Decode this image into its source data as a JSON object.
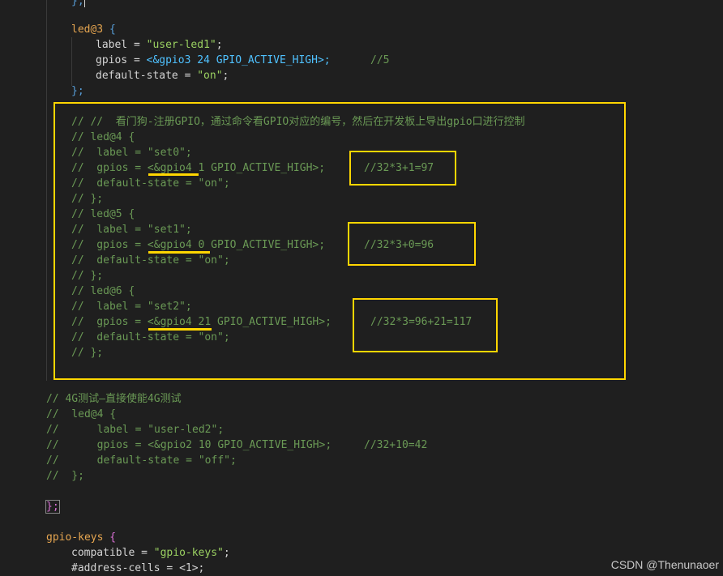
{
  "code": {
    "top_fragment": "};",
    "led3": {
      "name": "led@3",
      "open": "{",
      "label_key": "label",
      "label_value": "\"user-led1\"",
      "gpios_key": "gpios",
      "gpios_value": "<&gpio3 24 GPIO_ACTIVE_HIGH>;",
      "gpios_comment": "//5",
      "state_key": "default-state",
      "state_value": "\"on\"",
      "close": "};"
    },
    "block1": {
      "title": "// //  看门狗-注册GPIO，通过命令看GPIO对应的编号，然后在开发板上导出gpio口进行控制",
      "lines": [
        "// led@4 {",
        "//  label = \"set0\";",
        "//  gpios = <&gpio4 1 GPIO_ACTIVE_HIGH>;",
        "//  default-state = \"on\";",
        "// };",
        "// led@5 {",
        "//  label = \"set1\";",
        "//  gpios = <&gpio4 0 GPIO_ACTIVE_HIGH>;",
        "//  default-state = \"on\";",
        "// };",
        "// led@6 {",
        "//  label = \"set2\";",
        "//  gpios = <&gpio4 21 GPIO_ACTIVE_HIGH>;",
        "//  default-state = \"on\";",
        "// };"
      ],
      "notes": [
        "//32*3+1=97",
        "//32*3+0=96",
        "//32*3=96+21=117"
      ]
    },
    "block2": {
      "lines": [
        "// 4G测试—直接使能4G测试",
        "//  led@4 {",
        "//      label = \"user-led2\";",
        "//      gpios = <&gpio2 10 GPIO_ACTIVE_HIGH>;",
        "//      default-state = \"off\";",
        "//  };"
      ],
      "note": "//32+10=42"
    },
    "close_brace": "};",
    "gpio_keys": {
      "name": "gpio-keys",
      "open": "{",
      "compatible_key": "compatible",
      "compatible_value": "\"gpio-keys\"",
      "address_key": "#address-cells",
      "address_value": "<1>;"
    }
  },
  "watermark": "CSDN @Thenunaoer",
  "colors": {
    "background": "#1f1f1f",
    "annotation": "#ffd600",
    "comment": "#6a9955",
    "keyword": "#e5a550",
    "string": "#9ad061"
  }
}
